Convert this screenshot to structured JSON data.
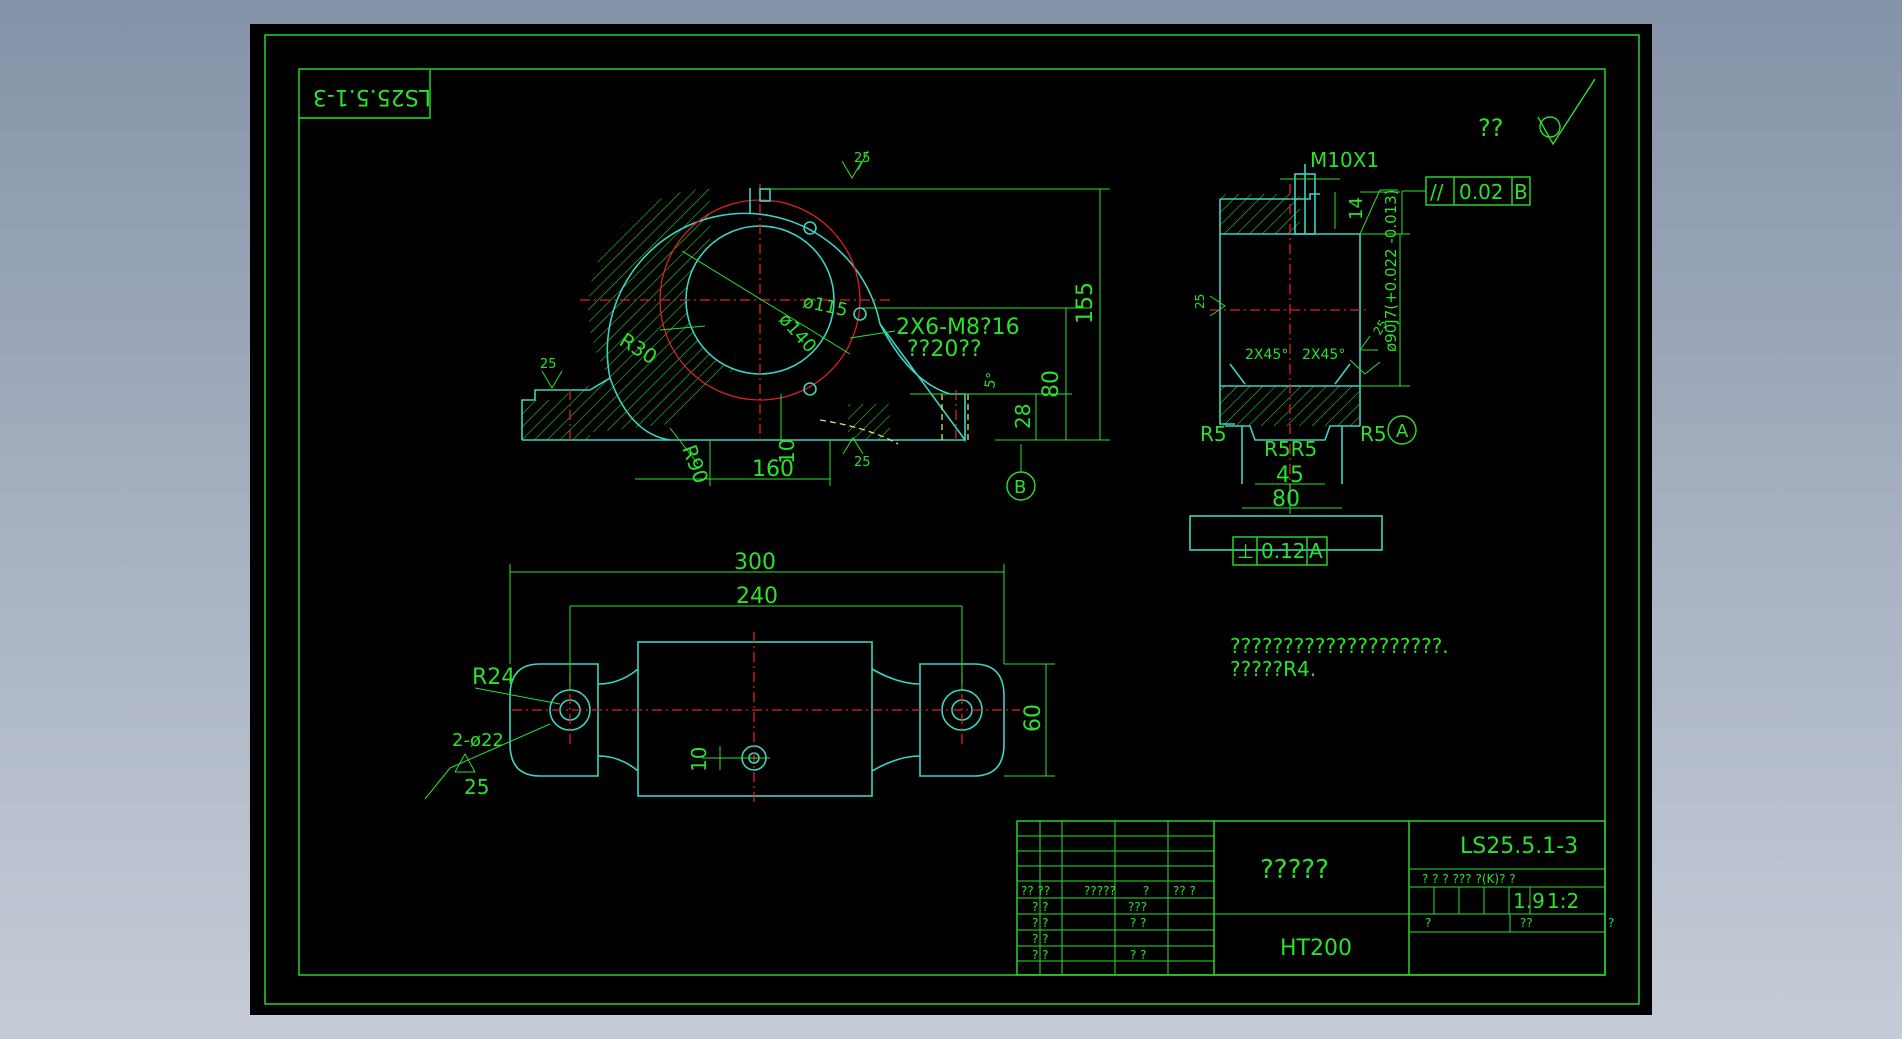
{
  "drawing": {
    "mirrored_code": "LS25.5.1-3",
    "surface_finish": "??",
    "front_view": {
      "roughness_top": "25",
      "roughness_left": "25",
      "roughness_bottom": "25",
      "dia_115": "ø115",
      "dia_140": "ø140",
      "thread_note_1": "2X6-M8?16",
      "thread_note_2": "??20??",
      "r30": "R30",
      "r90": "R90",
      "dim_160": "160",
      "dim_10": "10",
      "dim_155": "155",
      "dim_80": "80",
      "dim_28": "28",
      "angle_5": "5°",
      "datum_b": "B"
    },
    "side_view": {
      "thread": "M10X1",
      "dim_14": "14",
      "parallel_symbol": "//",
      "parallel_tol": "0.02",
      "parallel_datum": "B",
      "bore_fit": "ø90J7(+0.022 -0.013)",
      "roughness_left": "25",
      "roughness_right": "25",
      "chamfer_left": "2X45°",
      "chamfer_right": "2X45°",
      "r5_left": "R5",
      "r5_right": "R5",
      "r5_mid": "R5R5",
      "datum_a": "A",
      "dim_45": "45",
      "dim_80": "80",
      "perp_symbol": "⊥",
      "perp_tol": "0.12",
      "perp_datum": "A"
    },
    "top_view": {
      "dim_300": "300",
      "dim_240": "240",
      "r24": "R24",
      "holes": "2-ø22",
      "roughness": "25",
      "dim_60": "60",
      "dim_10": "10"
    },
    "notes": {
      "line1": "????????????????????.",
      "line2": "?????R4."
    },
    "title_block": {
      "part_name": "?????",
      "material": "HT200",
      "drawing_no": "LS25.5.1-3",
      "header_cells": "? ? ? ??? ?(K)? ?",
      "scale_left": "1.9",
      "scale": "1:2",
      "small_1": "?",
      "small_2": "??",
      "small_3": "?",
      "row_head_1": "?? ??",
      "row_head_2": "?????",
      "row_head_3": "?",
      "row_head_4": "?? ?",
      "row_1a": "? ?",
      "row_1b": "???",
      "row_2a": "? ?",
      "row_2b": "? ?",
      "row_3a": "? ?",
      "row_4a": "? ?",
      "row_4b": "? ?"
    }
  },
  "colors": {
    "line_green": "#2ce02c",
    "line_cyan": "#3ad4c4",
    "center_red": "#e02020",
    "hidden_yellow": "#e8e060",
    "paper": "#000000",
    "background": "#9aa5b6"
  }
}
